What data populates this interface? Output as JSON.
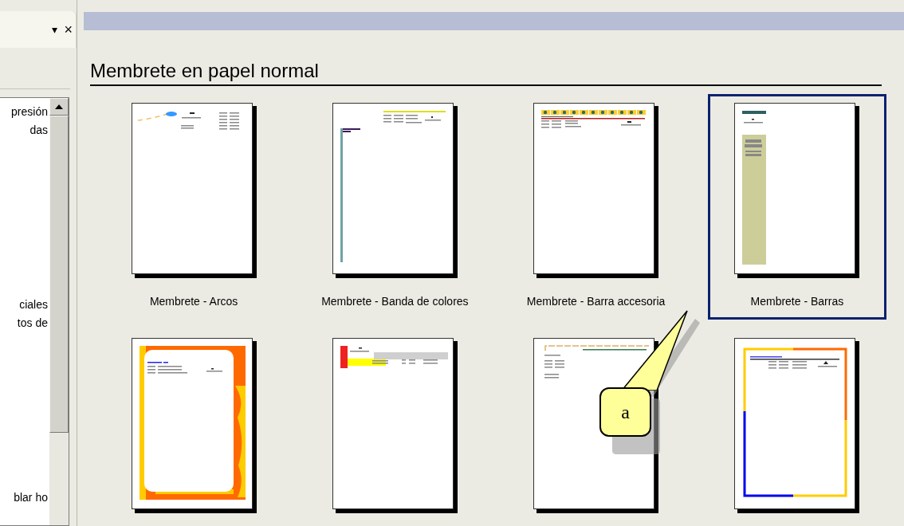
{
  "task_pane": {
    "menu_glyph": "▾",
    "close_glyph": "×",
    "list_items": [
      {
        "label": "presión"
      },
      {
        "label": "das"
      },
      {
        "label": "ciales"
      },
      {
        "label": "tos de"
      },
      {
        "label": "blar ho"
      }
    ]
  },
  "gallery": {
    "heading": "Membrete en papel normal",
    "templates": [
      {
        "kind": "arcs",
        "label": "Membrete - Arcos",
        "selected": false
      },
      {
        "kind": "band",
        "label": "Membrete - Banda de colores",
        "selected": false
      },
      {
        "kind": "accessory",
        "label": "Membrete - Barra accesoria",
        "selected": false
      },
      {
        "kind": "bars",
        "label": "Membrete - Barras",
        "selected": true
      },
      {
        "kind": "frame",
        "selected": false
      },
      {
        "kind": "blocks",
        "selected": false
      },
      {
        "kind": "line",
        "selected": false
      },
      {
        "kind": "colorframe",
        "selected": false
      }
    ]
  },
  "callout": {
    "text": "a"
  }
}
